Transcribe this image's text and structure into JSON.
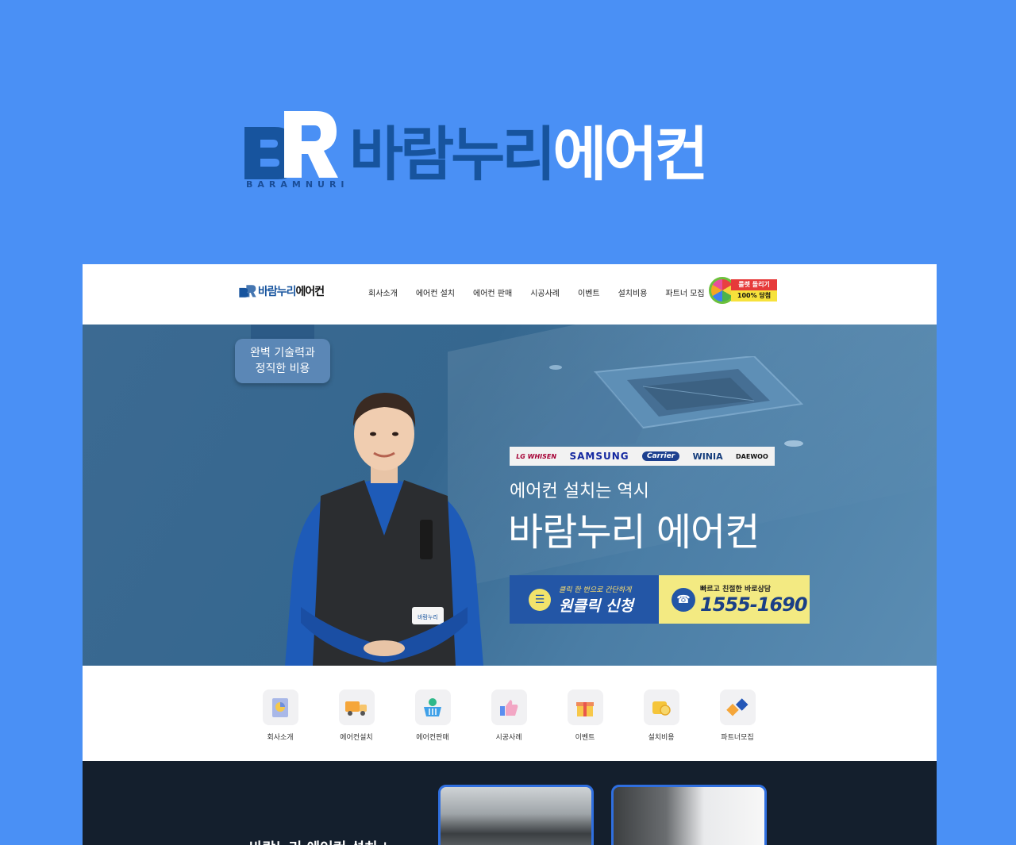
{
  "logo": {
    "mark": "BR",
    "sub": "BARAMNURI",
    "name_blue": "바람누리",
    "name_white": "에어컨"
  },
  "nav": {
    "logo_blue": "바람누리",
    "logo_dark": "에어컨",
    "menu": [
      "회사소개",
      "에어컨 설치",
      "에어컨 판매",
      "시공사례",
      "이벤트",
      "설치비용",
      "파트너 모집"
    ],
    "roulette_line1": "룰렛 돌리기",
    "roulette_line2": "100% 당첨"
  },
  "banner": {
    "badge_line1": "완벽 기술력과",
    "badge_line2": "정직한 비용",
    "brands": [
      "LG WHISEN",
      "SAMSUNG",
      "Carrier",
      "WINIA",
      "DAEWOO"
    ],
    "subtitle": "에어컨 설치는 역시",
    "title": "바람누리 에어컨",
    "cta_apply_small": "클릭 한 번으로 간단하게",
    "cta_apply_big": "원클릭 신청",
    "cta_call_small": "빠르고 친절한 바로상담",
    "cta_call_big": "1555-1690",
    "worker_tag": "바람누리"
  },
  "quick_menu": [
    "회사소개",
    "에어컨설치",
    "에어컨판매",
    "시공사례",
    "이벤트",
    "설치비용",
    "파트너모집"
  ],
  "section": {
    "heading": "바람누리 에어컨 설치 |"
  },
  "colors": {
    "background": "#4a90f5",
    "brand_blue": "#17549e",
    "cta_blue": "#2356a6",
    "cta_yellow": "#f3ea82",
    "dark_section": "#141f2d"
  }
}
